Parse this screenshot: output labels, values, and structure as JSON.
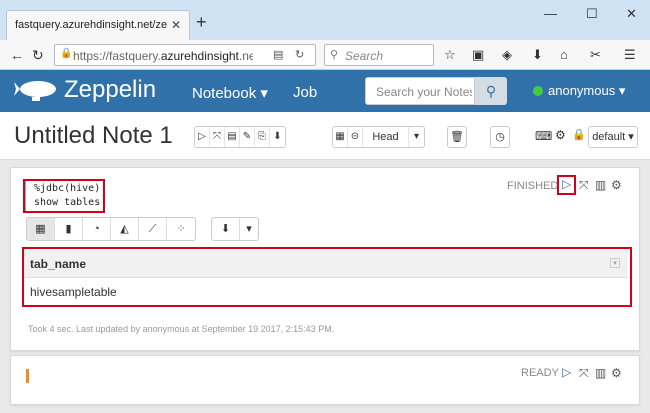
{
  "browser": {
    "tab_title": "fastquery.azurehdinsight.net/zeppelin",
    "url_plain": "https://fastquery.",
    "url_domain": "azurehdinsight",
    "url_tail": ".ne",
    "search_placeholder": "Search"
  },
  "zeppelin": {
    "brand": "Zeppelin",
    "nav_notebook": "Notebook ▾",
    "nav_job": "Job",
    "search_placeholder": "Search your Notes",
    "user": "anonymous ▾",
    "status_color": "#44cc44",
    "header_color": "#3071a9"
  },
  "note": {
    "title": "Untitled Note 1",
    "head_label": "Head",
    "interpreter_label": "default"
  },
  "paragraph1": {
    "code_line1": "%jdbc(hive)",
    "code_line2": "show tables",
    "status": "FINISHED",
    "table_header": "tab_name",
    "table_rows": [
      "hivesampletable"
    ],
    "meta": "Took 4 sec. Last updated by anonymous at September 19 2017, 2:15:43 PM."
  },
  "paragraph2": {
    "status": "READY"
  }
}
